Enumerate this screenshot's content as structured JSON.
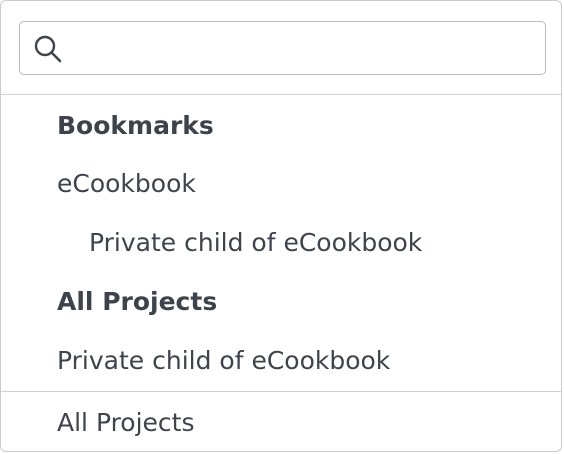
{
  "search": {
    "value": "",
    "placeholder": "",
    "icon": "search-icon"
  },
  "list": {
    "bookmarks_header": "Bookmarks",
    "bookmarks": [
      {
        "label": "eCookbook"
      },
      {
        "label": "Private child of eCookbook"
      }
    ],
    "all_projects_header": "All Projects",
    "projects": [
      {
        "label": "Private child of eCookbook"
      }
    ]
  },
  "footer": {
    "all_projects_link": "All Projects"
  },
  "colors": {
    "text": "#3e444c",
    "border": "#c8cbd0",
    "background": "#ffffff"
  }
}
